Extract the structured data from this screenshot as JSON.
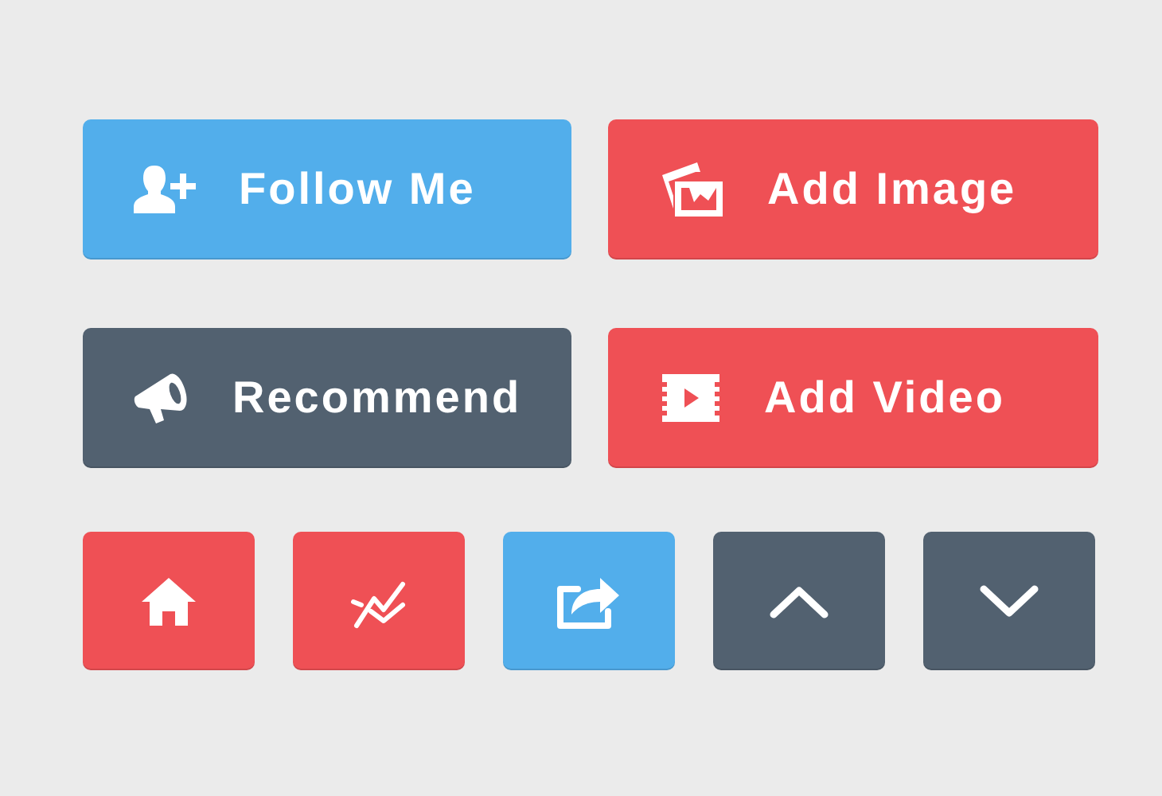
{
  "buttons": [
    {
      "label": "Follow Me",
      "kind": "user-plus",
      "color": "#52aeeb"
    },
    {
      "label": "Add Image",
      "kind": "images",
      "color": "#ef5055"
    },
    {
      "label": "Recommend",
      "kind": "megaphone",
      "color": "#526170"
    },
    {
      "label": "Add Video",
      "kind": "film",
      "color": "#ef5055"
    }
  ],
  "icon_buttons": [
    {
      "kind": "home",
      "color": "#ef5055"
    },
    {
      "kind": "chart",
      "color": "#ef5055"
    },
    {
      "kind": "share",
      "color": "#52aeeb"
    },
    {
      "kind": "up",
      "color": "#526170"
    },
    {
      "kind": "down",
      "color": "#526170"
    }
  ]
}
